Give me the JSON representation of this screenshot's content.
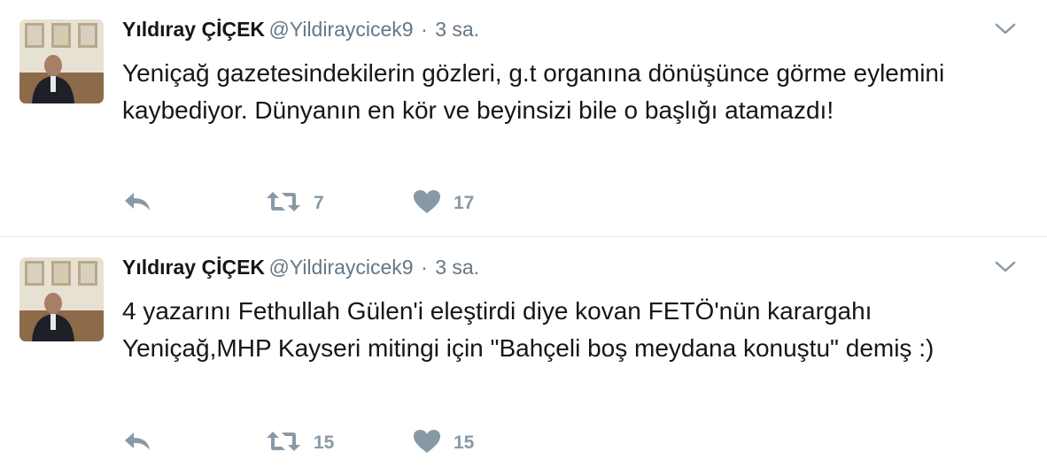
{
  "tweets": [
    {
      "author_name": "Yıldıray ÇİÇEK",
      "author_handle": "@Yildiraycicek9",
      "separator": "·",
      "time": "3 sa.",
      "text": "Yeniçağ gazetesindekilerin gözleri, g.t organına dönüşünce görme eylemini kaybediyor. Dünyanın en kör ve beyinsizi bile o başlığı atamazdı!",
      "retweet_count": "7",
      "like_count": "17"
    },
    {
      "author_name": "Yıldıray ÇİÇEK",
      "author_handle": "@Yildiraycicek9",
      "separator": "·",
      "time": "3 sa.",
      "text": "4 yazarını Fethullah Gülen'i eleştirdi diye kovan FETÖ'nün karargahı Yeniçağ,MHP Kayseri mitingi için \"Bahçeli boş meydana konuştu\" demiş :)",
      "retweet_count": "15",
      "like_count": "15"
    }
  ],
  "icons": {
    "reply": "reply-icon",
    "retweet": "retweet-icon",
    "like": "heart-icon",
    "more": "chevron-down-icon"
  },
  "colors": {
    "icon": "#8899a6",
    "handle": "#657786",
    "divider": "#e6ecf0"
  }
}
